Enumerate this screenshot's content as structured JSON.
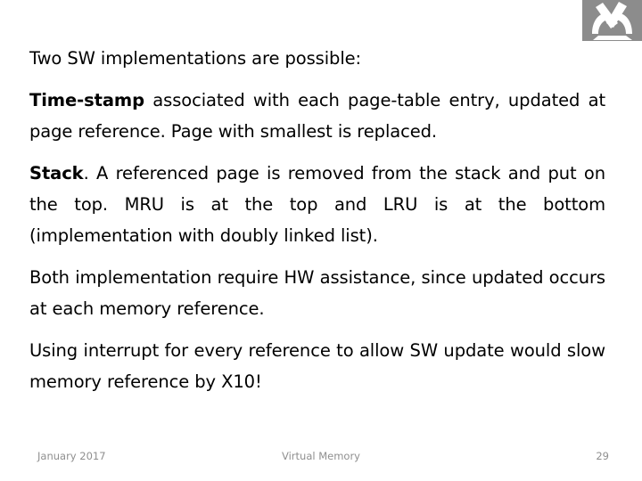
{
  "slide": {
    "background_color": "#ffffff",
    "text_color": "#000000",
    "footer_color": "#8f8f8f"
  },
  "logo": {
    "name": "microscope-logo",
    "background_color": "#8c8c8c",
    "glyph_color": "#ffffff"
  },
  "body": {
    "intro": "Two SW implementations are possible:",
    "timestamp_lead": "Time-stamp",
    "timestamp_rest": " associated with each page-table entry, updated at page reference. Page with smallest is replaced.",
    "stack_lead": "Stack",
    "stack_rest": ". A referenced page is removed from the stack and put on the top. MRU is at the top and LRU is at the bottom (implementation with doubly linked list).",
    "both": "Both implementation require HW assistance, since updated occurs at each memory reference.",
    "interrupt": "Using interrupt for every reference to allow SW update would slow memory reference by X10!"
  },
  "footer": {
    "date": "January 2017",
    "title": "Virtual Memory",
    "page_number": "29"
  }
}
